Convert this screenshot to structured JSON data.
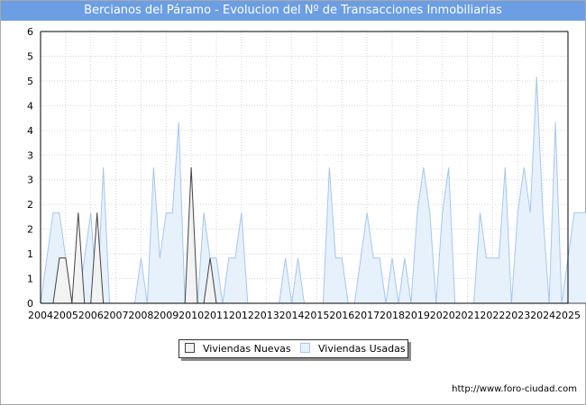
{
  "title": "Bercianos del Páramo - Evolucion del Nº de Transacciones Inmobiliarias",
  "footer": "http://www.foro-ciudad.com",
  "colors": {
    "title_bg": "#6b9ee3",
    "usadas_fill": "#e6f1fc",
    "usadas_line": "#a7c7ee",
    "nuevas_fill": "#f2f2f2",
    "nuevas_line": "#444444",
    "grid": "#d6d6d6"
  },
  "chart_data": {
    "type": "area",
    "title": "Bercianos del Páramo - Evolucion del Nº de Transacciones Inmobiliarias",
    "xlabel": "",
    "ylabel": "",
    "ylim": [
      0,
      6
    ],
    "yticks": [
      "0",
      "1",
      "1",
      "2",
      "2",
      "3",
      "3",
      "4",
      "4",
      "5",
      "5",
      "6"
    ],
    "x_start": "2004-Q1",
    "quarters_per_year": 4,
    "xticks": [
      "2004",
      "2005",
      "2006",
      "2007",
      "2008",
      "2009",
      "2010",
      "2011",
      "2012",
      "2013",
      "2014",
      "2015",
      "2016",
      "2017",
      "2018",
      "2019",
      "2020",
      "2021",
      "2022",
      "2023",
      "2024",
      "2025"
    ],
    "grid": true,
    "legend_position": "bottom",
    "series": [
      {
        "name": "Viviendas Nuevas",
        "values": [
          0,
          0,
          0,
          1,
          1,
          0,
          2,
          0,
          0,
          2,
          0,
          0,
          0,
          0,
          0,
          0,
          0,
          0,
          0,
          0,
          0,
          0,
          0,
          0,
          3,
          0,
          0,
          1,
          0,
          0,
          0,
          0,
          0,
          0,
          0,
          0,
          0,
          0,
          0,
          0,
          0,
          0,
          0,
          0,
          0,
          0,
          0,
          0,
          0,
          0,
          0,
          0,
          0,
          0,
          0,
          0,
          0,
          0,
          0,
          0,
          0,
          0,
          0,
          0,
          0,
          0,
          0,
          0,
          0,
          0,
          0,
          0,
          0,
          0,
          0,
          0,
          0,
          0,
          0,
          0,
          0,
          0,
          0,
          0,
          0,
          0,
          0,
          0,
          0,
          0
        ]
      },
      {
        "name": "Viviendas Usadas",
        "values": [
          0,
          1,
          2,
          2,
          1,
          0,
          0,
          1,
          2,
          0,
          3,
          0,
          0,
          0,
          0,
          0,
          1,
          0,
          3,
          1,
          2,
          2,
          4,
          0,
          2,
          0,
          2,
          1,
          1,
          0,
          1,
          1,
          2,
          0,
          0,
          0,
          0,
          0,
          0,
          1,
          0,
          1,
          0,
          0,
          0,
          0,
          3,
          1,
          1,
          0,
          0,
          1,
          2,
          1,
          1,
          0,
          1,
          0,
          1,
          0,
          2,
          3,
          2,
          0,
          2,
          3,
          0,
          0,
          0,
          0,
          2,
          1,
          1,
          1,
          3,
          0,
          2,
          3,
          2,
          5,
          2,
          0,
          4,
          0,
          1,
          2,
          2,
          2,
          3,
          1
        ]
      }
    ]
  }
}
